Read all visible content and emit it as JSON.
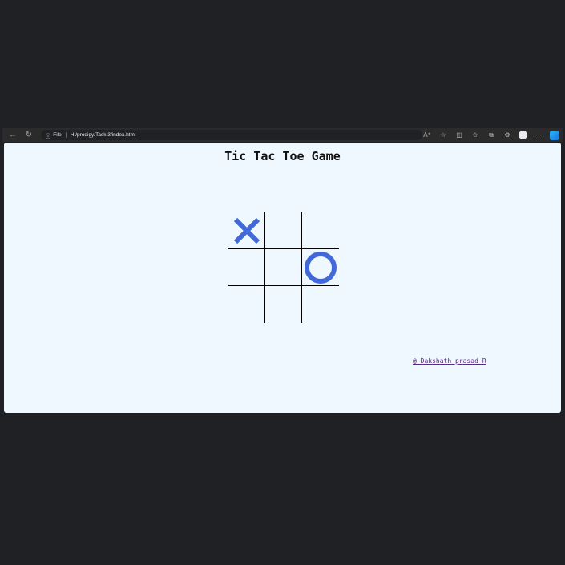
{
  "browser": {
    "address": {
      "scheme_label": "File",
      "url": "H:/prodigy/Task 3/index.html"
    },
    "icons": [
      "back-icon",
      "refresh-icon",
      "info-icon",
      "read-aloud-icon",
      "favorite-icon",
      "split-screen-icon",
      "favorites-icon",
      "collections-icon",
      "extensions-icon",
      "profile-icon",
      "more-icon",
      "copilot-icon"
    ]
  },
  "page": {
    "title": "Tic Tac Toe Game",
    "board": [
      "X",
      "",
      "",
      "",
      "",
      "O",
      "",
      "",
      ""
    ],
    "mark_color": "#4169d9",
    "footer_link": "@_Dakshath prasad R"
  }
}
